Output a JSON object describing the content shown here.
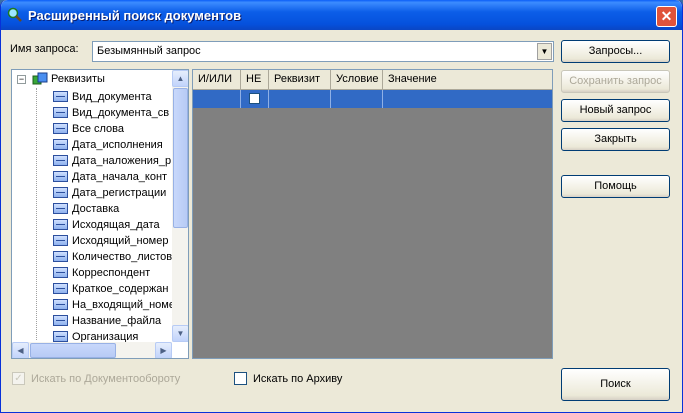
{
  "window": {
    "title": "Расширенный поиск документов"
  },
  "query": {
    "label": "Имя запроса:",
    "value": "Безымянный запрос"
  },
  "buttons": {
    "queries": "Запросы...",
    "save_query": "Сохранить запрос",
    "new_query": "Новый запрос",
    "close": "Закрыть",
    "help": "Помощь",
    "search": "Поиск"
  },
  "tree": {
    "root": "Реквизиты",
    "items": [
      "Вид_документа",
      "Вид_документа_св",
      "Все слова",
      "Дата_исполнения",
      "Дата_наложения_р",
      "Дата_начала_конт",
      "Дата_регистрации",
      "Доставка",
      "Исходящая_дата",
      "Исходящий_номер",
      "Количество_листов",
      "Корреспондент",
      "Краткое_содержан",
      "На_входящий_номе",
      "Название_файла",
      "Организация"
    ]
  },
  "grid": {
    "columns": [
      "И/ИЛИ",
      "НЕ",
      "Реквизит",
      "Условие",
      "Значение"
    ]
  },
  "options": {
    "search_docflow": {
      "label": "Искать по Документообороту",
      "checked": true,
      "enabled": false
    },
    "search_archive": {
      "label": "Искать по Архиву",
      "checked": false,
      "enabled": true
    }
  }
}
